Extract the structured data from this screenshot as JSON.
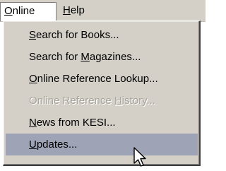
{
  "menubar": {
    "items": [
      {
        "label": "Online",
        "accel_index": 0,
        "active": true
      },
      {
        "label": "Help",
        "accel_index": 0,
        "active": false
      }
    ]
  },
  "dropdown": {
    "items": [
      {
        "pre": "",
        "accel": "S",
        "post": "earch for Books...",
        "state": "enabled"
      },
      {
        "pre": "Search for ",
        "accel": "M",
        "post": "agazines...",
        "state": "enabled"
      },
      {
        "pre": "",
        "accel": "O",
        "post": "nline Reference Lookup...",
        "state": "enabled"
      },
      {
        "pre": "Online Reference ",
        "accel": "H",
        "post": "istory...",
        "state": "disabled"
      },
      {
        "pre": "",
        "accel": "N",
        "post": "ews from KESI...",
        "state": "enabled"
      },
      {
        "pre": "",
        "accel": "U",
        "post": "pdates...",
        "state": "highlighted"
      }
    ]
  },
  "cursor": {
    "icon": "arrow-cursor-icon"
  }
}
